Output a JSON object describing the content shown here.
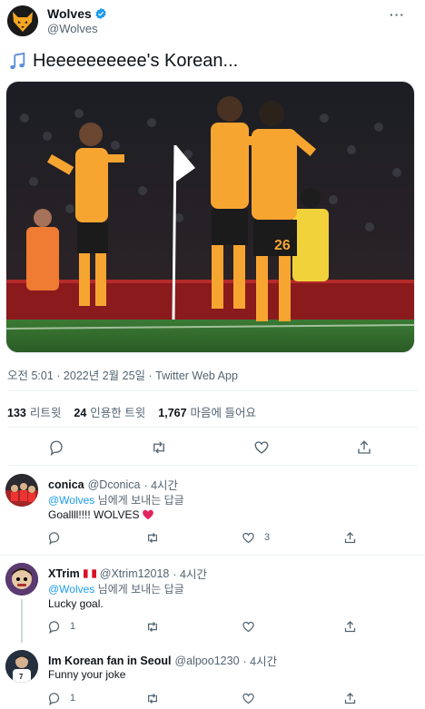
{
  "author": {
    "name": "Wolves",
    "handle": "@Wolves"
  },
  "tweet": {
    "text": "Heeeeeeeeee's Korean...",
    "timestamp": "오전 5:01 · 2022년 2월 25일 · Twitter Web App",
    "stats": {
      "retweets_count": "133",
      "retweets_label": "리트윗",
      "quotes_count": "24",
      "quotes_label": "인용한 트윗",
      "likes_count": "1,767",
      "likes_label": "마음에 들어요"
    },
    "media_jersey_number": "26"
  },
  "replies": [
    {
      "name": "conica",
      "handle": "@Dconica",
      "time": "· 4시간",
      "replying_mention": "@Wolves",
      "replying_suffix": "님에게 보내는 답글",
      "text": "Goallll!!!! WOLVES",
      "like_count": "3"
    },
    {
      "name": "XTrim",
      "handle": "@Xtrim12018",
      "time": "· 4시간",
      "replying_mention": "@Wolves",
      "replying_suffix": "님에게 보내는 답글",
      "text": "Lucky goal.",
      "reply_count": "1"
    },
    {
      "name": "Im Korean fan in Seoul",
      "handle": "@alpoo1230",
      "time": "· 4시간",
      "text": "Funny your joke",
      "reply_count": "1"
    }
  ],
  "colors": {
    "accent": "#1d9bf0",
    "text": "#0f1419",
    "muted": "#536471",
    "wolves_gold": "#f5a623",
    "heart": "#e0245e"
  },
  "icons": [
    "wolves-logo-icon",
    "verified-badge-icon",
    "more-icon",
    "music-notes-icon",
    "reply-icon",
    "retweet-icon",
    "like-icon",
    "share-icon",
    "flag-peru-icon",
    "heart-emoji-icon"
  ]
}
